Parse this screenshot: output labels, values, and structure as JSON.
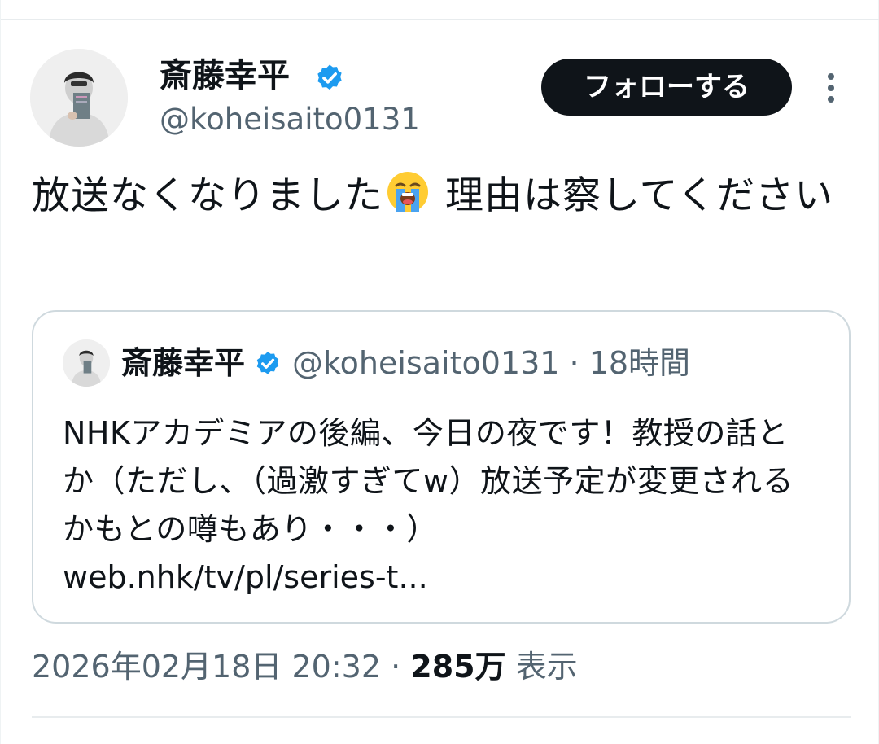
{
  "author": {
    "display_name": "斎藤幸平",
    "handle": "@koheisaito0131",
    "verified": true
  },
  "follow_button": {
    "label": "フォローする"
  },
  "more_button": {
    "icon": "more-vertical-icon"
  },
  "tweet": {
    "text_before_emoji": "放送なくなりました",
    "emoji": "loudly-crying-face-emoji",
    "text_after_emoji": " 理由は察してください"
  },
  "quoted_tweet": {
    "display_name": "斎藤幸平",
    "handle": "@koheisaito0131",
    "separator": " · ",
    "time_ago": "18時間",
    "text": "NHKアカデミアの後編、今日の夜です！教授の話とか（ただし、（過激すぎてw）放送予定が変更されるかもとの噂もあり・・・）",
    "link": "web.nhk/tv/pl/series-t..."
  },
  "meta": {
    "timestamp": "2026年02月18日 20:32",
    "separator": " · ",
    "views_count": "285万",
    "views_label": " 表示"
  },
  "colors": {
    "text_primary": "#0f1419",
    "text_secondary": "#536471",
    "verified_blue": "#1d9bf0",
    "border": "#cfd9de",
    "follow_bg": "#0f1419"
  }
}
